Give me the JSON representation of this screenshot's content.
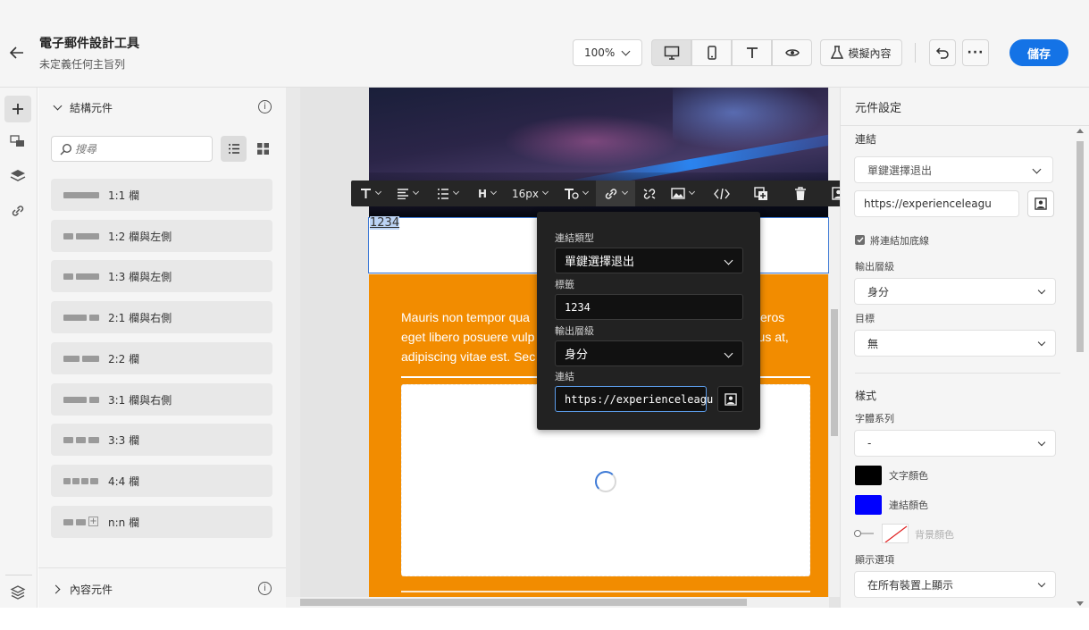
{
  "header": {
    "title": "電子郵件設計工具",
    "subtitle": "未定義任何主旨列",
    "zoom": "100%",
    "simulate_label": "模擬內容",
    "save_label": "儲存"
  },
  "left_panel": {
    "structure_title": "結構元件",
    "search_placeholder": "搜尋",
    "items": [
      {
        "label": "1:1 欄"
      },
      {
        "label": "1:2 欄與左側"
      },
      {
        "label": "1:3 欄與左側"
      },
      {
        "label": "2:1 欄與右側"
      },
      {
        "label": "2:2 欄"
      },
      {
        "label": "3:1 欄與右側"
      },
      {
        "label": "3:3 欄"
      },
      {
        "label": "4:4 欄"
      },
      {
        "label": "n:n 欄"
      }
    ],
    "content_title": "內容元件"
  },
  "toolbar": {
    "font_size": "16px"
  },
  "canvas": {
    "link_text": "1234",
    "body_text_lines": [
      "Mauris non tempor qua",
      "eget libero posuere vulp",
      "adipiscing vitae est. Sec"
    ],
    "body_text_right": [
      "eros",
      "arius at,",
      ""
    ]
  },
  "popup": {
    "link_type_label": "連結類型",
    "link_type_value": "單鍵選擇退出",
    "tag_label": "標籤",
    "tag_value": "1234",
    "output_label": "輸出層級",
    "output_value": "身分",
    "link_label": "連結",
    "link_value": "https://experienceleagu"
  },
  "right_panel": {
    "title": "元件設定",
    "link_section": "連結",
    "link_type": "單鍵選擇退出",
    "url": "https://experienceleagu",
    "underline_label": "將連結加底線",
    "output_label": "輸出層級",
    "output_value": "身分",
    "target_label": "目標",
    "target_value": "無",
    "style_section": "樣式",
    "font_family_label": "字體系列",
    "font_family_value": "-",
    "text_color_label": "文字顏色",
    "link_color_label": "連結顏色",
    "bg_color_label": "背景顏色",
    "display_label": "顯示選項",
    "display_value": "在所有裝置上顯示"
  },
  "colors": {
    "accent": "#1473e6",
    "orange": "#f28c00",
    "text_color": "#000000",
    "link_color": "#0000ff"
  }
}
